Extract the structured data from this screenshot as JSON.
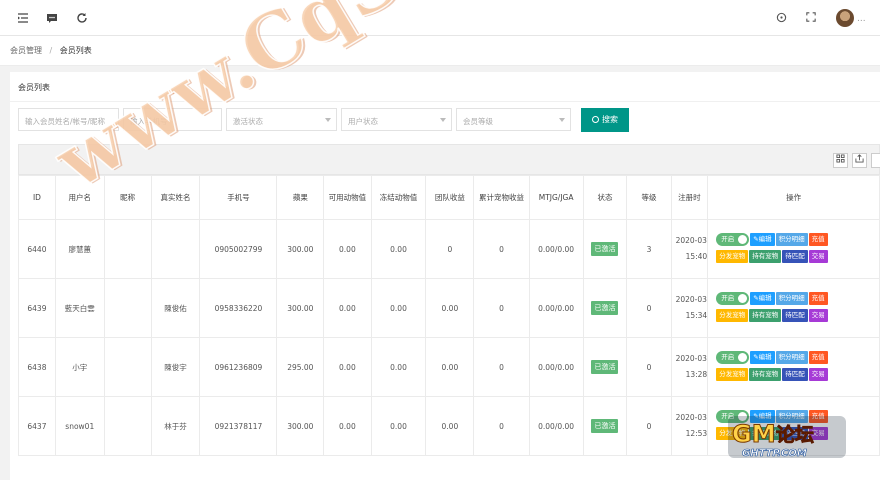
{
  "topbar": {
    "icons": [
      "menu-fold-icon",
      "message-icon",
      "refresh-icon",
      "palette-icon",
      "fullscreen-icon"
    ],
    "more": "..."
  },
  "breadcrumb": {
    "parent": "会员管理",
    "separator": "/",
    "current": "会员列表"
  },
  "card": {
    "title": "会员列表"
  },
  "filters": {
    "account_placeholder": "输入会员姓名/帐号/昵称",
    "phone_placeholder": "输入手机号",
    "activation_status": "激活状态",
    "user_status": "用户状态",
    "member_level": "会员等级",
    "search_label": "搜索"
  },
  "toolbar": {
    "icons": [
      "columns-icon",
      "export-icon",
      "print-icon"
    ]
  },
  "table": {
    "headers": [
      "ID",
      "用户名",
      "昵称",
      "真实姓名",
      "手机号",
      "蘋果",
      "可用动物值",
      "冻结动物值",
      "团队收益",
      "累计宠物收益",
      "MTJG/JGA",
      "状态",
      "等级",
      "注册时",
      "操作"
    ],
    "rows": [
      {
        "id": "6440",
        "username": "廖慧蕙",
        "nickname": "",
        "realname": "",
        "phone": "0905002799",
        "apple": "300.00",
        "avail": "0.00",
        "frozen": "0.00",
        "team": "0",
        "pet": "0",
        "mtjg": "0.00/0.00",
        "status": "已激活",
        "level": "3",
        "date": "2020-03",
        "time": "15:40"
      },
      {
        "id": "6439",
        "username": "藍天白雲",
        "nickname": "",
        "realname": "陳俊佑",
        "phone": "0958336220",
        "apple": "300.00",
        "avail": "0.00",
        "frozen": "0.00",
        "team": "0.00",
        "pet": "0",
        "mtjg": "0.00/0.00",
        "status": "已激活",
        "level": "0",
        "date": "2020-03",
        "time": "15:34"
      },
      {
        "id": "6438",
        "username": "小宇",
        "nickname": "",
        "realname": "陳俊宇",
        "phone": "0961236809",
        "apple": "295.00",
        "avail": "0.00",
        "frozen": "0.00",
        "team": "0.00",
        "pet": "0",
        "mtjg": "0.00/0.00",
        "status": "已激活",
        "level": "0",
        "date": "2020-03",
        "time": "13:28"
      },
      {
        "id": "6437",
        "username": "snow01",
        "nickname": "",
        "realname": "林于芬",
        "phone": "0921378117",
        "apple": "300.00",
        "avail": "0.00",
        "frozen": "0.00",
        "team": "0.00",
        "pet": "0",
        "mtjg": "0.00/0.00",
        "status": "已激活",
        "level": "0",
        "date": "2020-03",
        "time": "12:53"
      }
    ],
    "ops": {
      "toggle": "开启",
      "edit": "编辑",
      "points": "积分明细",
      "recharge": "充值",
      "distribute": "分发宠物",
      "hold": "持有宠物",
      "pending": "待匹配",
      "trade": "交易"
    }
  },
  "watermark": {
    "text": "www.CqSYBB.Com"
  },
  "logo": {
    "top": "GM",
    "mid": "论坛",
    "bottom": "GHTTP.COM"
  },
  "colors": {
    "primary": "#009688",
    "active": "#5fb878",
    "blue": "#1e9fff",
    "orange": "#ff5722"
  }
}
